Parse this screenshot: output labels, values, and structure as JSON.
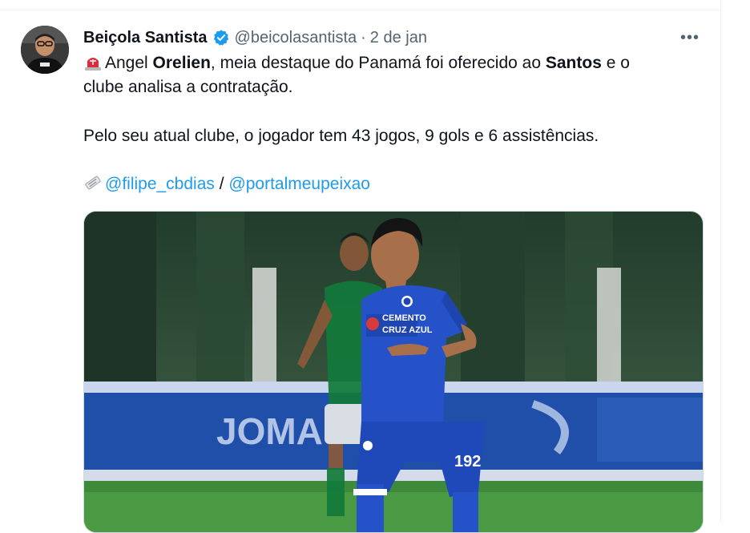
{
  "tweet": {
    "author_name": "Beiçola Santista",
    "handle": "@beicolasantista",
    "separator": "·",
    "date": "2 de jan",
    "more_label": "•••",
    "line1": {
      "emoji": "rotating-light-icon",
      "part1": "Angel ",
      "bold1": "Orelien",
      "part2": ", meia destaque do Panamá foi oferecido ao ",
      "bold2": "Santos",
      "part3": " e o"
    },
    "line2": "clube analisa a contratação.",
    "line3": "Pelo seu atual clube, o jogador tem 43 jogos, 9 gols e 6 assistências.",
    "credits": {
      "emoji": "newspaper-icon",
      "link1": "@filipe_cbdias",
      "sep": " / ",
      "link2": "@portalmeupeixao"
    }
  },
  "photo": {
    "sponsor_line1": "CEMENTO",
    "sponsor_line2": "CRUZ AZUL",
    "jersey_number": "192",
    "board_text": "JOMA",
    "colors": {
      "jersey": "#2552c9",
      "pitch": "#3f8a3a",
      "board": "#1f4fa8",
      "link": "#1d9bf0",
      "verified": "#1d9bf0"
    }
  }
}
